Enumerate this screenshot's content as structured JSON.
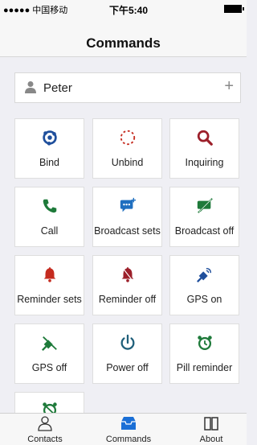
{
  "status": {
    "carrier": "●●●●● 中国移动",
    "time": "下午5:40"
  },
  "nav": {
    "title": "Commands"
  },
  "user": {
    "name": "Peter",
    "add_symbol": "+"
  },
  "commands": [
    {
      "label": "Bind",
      "icon": "bind-icon"
    },
    {
      "label": "Unbind",
      "icon": "unbind-icon"
    },
    {
      "label": "Inquiring",
      "icon": "search-icon"
    },
    {
      "label": "Call",
      "icon": "phone-icon"
    },
    {
      "label": "Broadcast sets",
      "icon": "chat-add-icon"
    },
    {
      "label": "Broadcast off",
      "icon": "chat-off-icon"
    },
    {
      "label": "Reminder sets",
      "icon": "bell-icon"
    },
    {
      "label": "Reminder off",
      "icon": "bell-off-icon"
    },
    {
      "label": "GPS on",
      "icon": "satellite-icon"
    },
    {
      "label": "GPS off",
      "icon": "satellite-off-icon"
    },
    {
      "label": "Power off",
      "icon": "power-icon"
    },
    {
      "label": "Pill reminder",
      "icon": "alarm-clock-icon"
    }
  ],
  "tabs": [
    {
      "label": "Contacts",
      "icon": "person-icon",
      "active": false
    },
    {
      "label": "Commands",
      "icon": "inbox-icon",
      "active": true
    },
    {
      "label": "About",
      "icon": "book-icon",
      "active": false
    }
  ],
  "colors": {
    "blue": "#1f4f9c",
    "red": "#c52b1f",
    "green": "#1e7a3a",
    "tab_active": "#1a6fd6"
  }
}
